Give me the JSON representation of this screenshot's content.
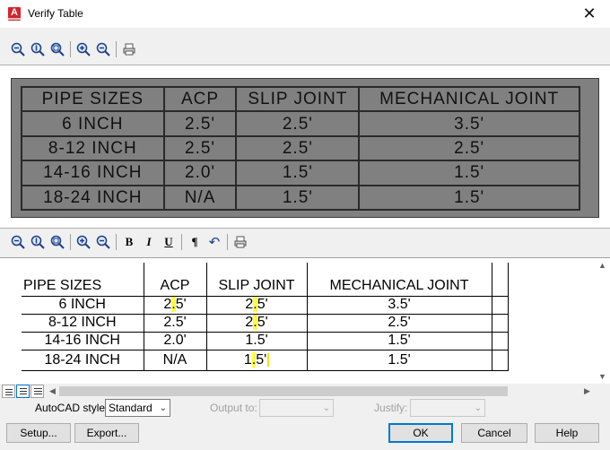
{
  "window": {
    "title": "Verify Table",
    "close_glyph": "✕"
  },
  "toolbar_top": {
    "icons": [
      "zoom-out-icon",
      "zoom-window-icon",
      "zoom-extents-icon",
      "zoom-in-icon",
      "zoom-out-small-icon",
      "print-icon"
    ]
  },
  "toolbar_edit": {
    "bold_label": "B",
    "italic_label": "I",
    "underline_label": "U",
    "paragraph_label": "¶",
    "undo_glyph": "↶"
  },
  "preview_table": {
    "header": [
      "PIPE SIZES",
      "ACP",
      "SLIP JOINT",
      "MECHANICAL JOINT"
    ],
    "rows": [
      [
        "6 INCH",
        "2.5'",
        "2.5'",
        "3.5'"
      ],
      [
        "8-12 INCH",
        "2.5'",
        "2.5'",
        "2.5'"
      ],
      [
        "14-16 INCH",
        "2.0'",
        "1.5'",
        "1.5'"
      ],
      [
        "18-24 INCH",
        "N/A",
        "1.5'",
        "1.5'"
      ]
    ]
  },
  "editor_table": {
    "header": [
      "PIPE SIZES",
      "ACP",
      "SLIP JOINT",
      "MECHANICAL JOINT"
    ],
    "rows": [
      [
        "6 INCH",
        "2.5'",
        "2.5'",
        "3.5'"
      ],
      [
        "8-12 INCH",
        "2.5'",
        "2.5'",
        "2.5'"
      ],
      [
        "14-16 INCH",
        "2.0'",
        "1.5'",
        "1.5'"
      ],
      [
        "18-24 INCH",
        "N/A",
        "1.5'",
        "1.5'"
      ]
    ],
    "highlight_color": "#ffff40"
  },
  "options": {
    "style_label": "AutoCAD style:",
    "style_value": "Standard",
    "output_label": "Output to:",
    "output_value": "",
    "justify_label": "Justify:",
    "justify_value": ""
  },
  "buttons": {
    "setup": "Setup...",
    "export": "Export...",
    "ok": "OK",
    "cancel": "Cancel",
    "help": "Help"
  },
  "colors": {
    "accent": "#0078d7",
    "brand": "#d5232a",
    "preview_bg": "#808080"
  }
}
